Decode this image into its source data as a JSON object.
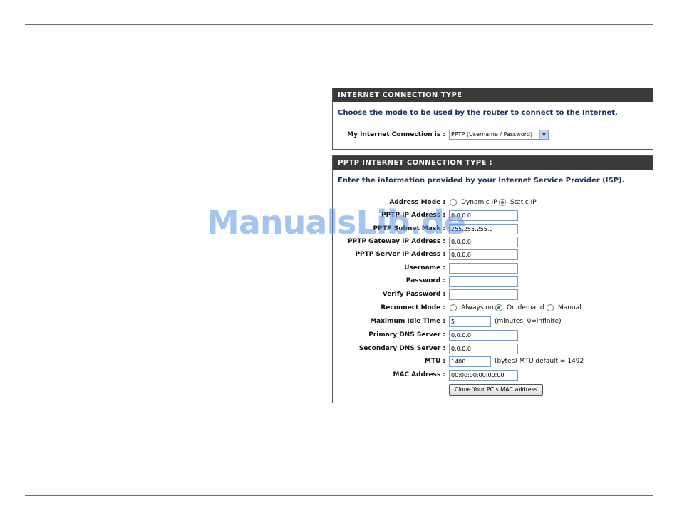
{
  "watermark": "ManualsLib.de",
  "connection_type": {
    "header": "INTERNET CONNECTION TYPE",
    "intro": "Choose the mode to be used by the router to connect to the Internet.",
    "label": "My Internet Connection is :",
    "selected": "PPTP (Username / Password)"
  },
  "pptp": {
    "header": "PPTP INTERNET CONNECTION TYPE :",
    "intro": "Enter the information provided by your Internet Service Provider (ISP).",
    "address_mode": {
      "label": "Address Mode :",
      "options": [
        "Dynamic IP",
        "Static IP"
      ],
      "selected": "Static IP"
    },
    "ip_address": {
      "label": "PPTP IP Address :",
      "value": "0.0.0.0"
    },
    "subnet_mask": {
      "label": "PPTP Subnet Mask :",
      "value": "255.255.255.0"
    },
    "gateway": {
      "label": "PPTP Gateway IP Address :",
      "value": "0.0.0.0"
    },
    "server": {
      "label": "PPTP Server IP Address :",
      "value": "0.0.0.0"
    },
    "username": {
      "label": "Username :",
      "value": ""
    },
    "password": {
      "label": "Password :",
      "value": ""
    },
    "verify_password": {
      "label": "Verify Password :",
      "value": ""
    },
    "reconnect_mode": {
      "label": "Reconnect Mode :",
      "options": [
        "Always on",
        "On demand",
        "Manual"
      ],
      "selected": "On demand"
    },
    "idle_time": {
      "label": "Maximum Idle Time :",
      "value": "5",
      "hint": "(minutes, 0=infinite)"
    },
    "primary_dns": {
      "label": "Primary DNS Server :",
      "value": "0.0.0.0"
    },
    "secondary_dns": {
      "label": "Secondary DNS Server :",
      "value": "0.0.0.0"
    },
    "mtu": {
      "label": "MTU :",
      "value": "1400",
      "hint": "(bytes) MTU default = 1492"
    },
    "mac": {
      "label": "MAC Address :",
      "value": "00:00:00:00:00:00"
    },
    "clone_button": "Clone Your PC's MAC address"
  }
}
